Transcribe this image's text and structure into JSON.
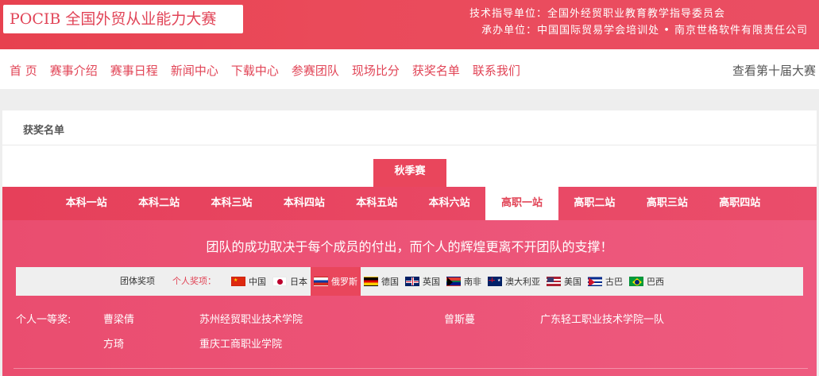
{
  "header": {
    "logo_text": "POCIB 全国外贸从业能力大赛",
    "sponsor_line1": "技术指导单位：全国外经贸职业教育教学指导委员会",
    "sponsor_line2": "承办单位：中国国际贸易学会培训处 • 南京世格软件有限责任公司"
  },
  "nav": {
    "items": [
      "首 页",
      "赛事介绍",
      "赛事日程",
      "新闻中心",
      "下载中心",
      "参赛团队",
      "现场比分",
      "获奖名单",
      "联系我们"
    ],
    "right_link": "查看第十届大赛"
  },
  "breadcrumb": {
    "label": "获奖名单"
  },
  "season_tab": {
    "label": "秋季赛"
  },
  "stations": {
    "items": [
      "本科一站",
      "本科二站",
      "本科三站",
      "本科四站",
      "本科五站",
      "本科六站",
      "高职一站",
      "高职二站",
      "高职三站",
      "高职四站"
    ],
    "active_index": 6
  },
  "slogan": "团队的成功取决于每个成员的付出，而个人的辉煌更离不开团队的支撑！",
  "country_bar": {
    "team_label": "团体奖项",
    "individual_label": "个人奖项：",
    "countries": [
      {
        "name": "中国",
        "flag": "china-flag"
      },
      {
        "name": "日本",
        "flag": "japan-flag"
      },
      {
        "name": "俄罗斯",
        "flag": "russia-flag"
      },
      {
        "name": "德国",
        "flag": "germany-flag"
      },
      {
        "name": "英国",
        "flag": "uk-flag"
      },
      {
        "name": "南非",
        "flag": "south-africa-flag"
      },
      {
        "name": "澳大利亚",
        "flag": "australia-flag"
      },
      {
        "name": "美国",
        "flag": "usa-flag"
      },
      {
        "name": "古巴",
        "flag": "cuba-flag"
      },
      {
        "name": "巴西",
        "flag": "brazil-flag"
      }
    ],
    "active_index": 2
  },
  "awards": {
    "category": "个人一等奖:",
    "rows": [
      [
        {
          "name": "曹梁倩",
          "school": "苏州经贸职业技术学院"
        },
        {
          "name": "曾斯蔓",
          "school": "广东轻工职业技术学院一队"
        }
      ],
      [
        {
          "name": "方琦",
          "school": "重庆工商职业学院"
        }
      ]
    ]
  },
  "colors": {
    "accent": "#e14456",
    "band": "#e9465c",
    "content_pink": "#ec537a"
  }
}
